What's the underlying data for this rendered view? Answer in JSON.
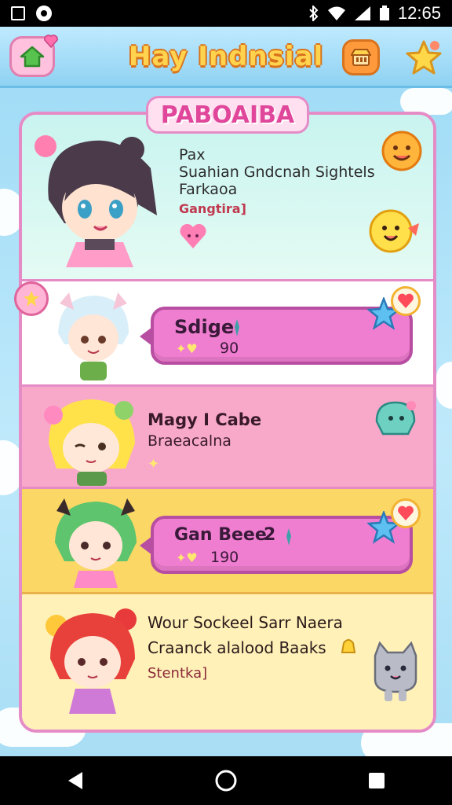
{
  "status_bar": {
    "time": "12:65"
  },
  "header": {
    "title": "Hay Indnsial"
  },
  "panel": {
    "title": "PABOAIBA"
  },
  "rows": [
    {
      "line1": "Pax",
      "line2": "Suahian Gndcnah Sightels",
      "line3": "Farkaoa",
      "tag": "Gangtira]"
    },
    {
      "bubble_label": "Sdige",
      "bubble_value": "90"
    },
    {
      "line1": "Magy I Cabe",
      "line2": "Braeacalna"
    },
    {
      "bubble_label": "Gan Beee",
      "bubble_label_num": "2",
      "bubble_value": "190"
    },
    {
      "line1": "Wour Sockeel Sarr Naera",
      "line2": "Craanck alalood Baaks",
      "tag": "Stentka]"
    }
  ],
  "colors": {
    "accent_pink": "#e58cc7",
    "title_yellow": "#ffd34d",
    "bubble_pink": "#f07ed0",
    "row_yellow": "#fbd765",
    "row_pink": "#f8a9c9"
  }
}
